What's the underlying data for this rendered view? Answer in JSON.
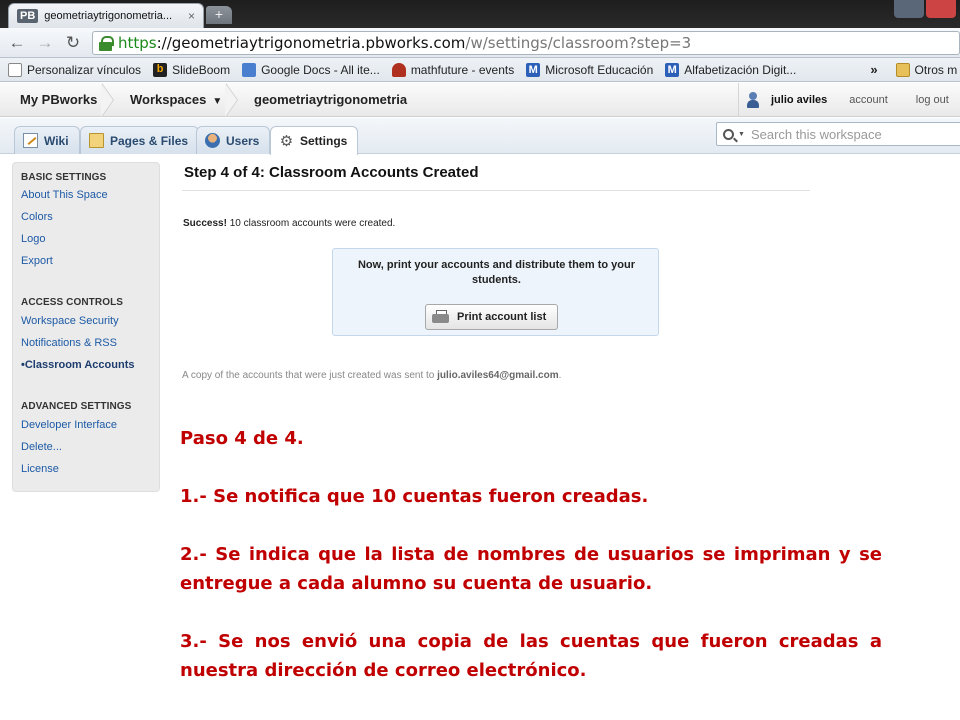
{
  "browser": {
    "tab_favicon": "PB",
    "tab_title": "geometriaytrigonometria...",
    "tab_close": "×",
    "new_tab": "+",
    "back": "←",
    "forward": "→",
    "reload": "↻",
    "url_proto": "https",
    "url_host": "://geometriaytrigonometria.pbworks.com",
    "url_path": "/w/settings/classroom?step=3",
    "bookmarks": [
      {
        "label": "Personalizar vínculos",
        "icon": "page-icon"
      },
      {
        "label": "SlideBoom",
        "icon": "slideboom-icon"
      },
      {
        "label": "Google Docs - All ite...",
        "icon": "google-docs-icon"
      },
      {
        "label": "mathfuture - events",
        "icon": "mathfuture-icon"
      },
      {
        "label": "Microsoft Educación",
        "icon": "microsoft-icon"
      },
      {
        "label": "Alfabetización Digit...",
        "icon": "microsoft-icon"
      }
    ],
    "bookmarks_more": "»",
    "other_bookmarks": "Otros m"
  },
  "header": {
    "my_pbworks": "My PBworks",
    "workspaces": "Workspaces",
    "workspaces_chevron": "▼",
    "workspace_name": "geometriaytrigonometria",
    "username": "julio aviles",
    "account": "account",
    "logout": "log out"
  },
  "tabs": [
    {
      "label": "Wiki",
      "active": false
    },
    {
      "label": "Pages & Files",
      "active": false
    },
    {
      "label": "Users",
      "active": false
    },
    {
      "label": "Settings",
      "active": true
    }
  ],
  "search": {
    "placeholder": "Search this workspace"
  },
  "sidebar": {
    "basic_head": "BASIC SETTINGS",
    "basic_items": [
      "About This Space",
      "Colors",
      "Logo",
      "Export"
    ],
    "access_head": "ACCESS CONTROLS",
    "access_items": [
      "Workspace Security",
      "Notifications & RSS",
      "Classroom Accounts"
    ],
    "current_marker": "•",
    "advanced_head": "ADVANCED SETTINGS",
    "advanced_items": [
      "Developer Interface",
      "Delete...",
      "License"
    ]
  },
  "main": {
    "title": "Step 4 of 4: Classroom Accounts Created",
    "success_label": "Success!",
    "success_text": " 10 classroom accounts were created.",
    "notice_text": "Now, print your accounts and distribute them to your students.",
    "print_button": "Print account list",
    "copy_prefix": "A copy of the accounts that were just created was sent to ",
    "copy_email": "julio.aviles64@gmail.com",
    "copy_suffix": "."
  },
  "annotation": {
    "line1": "Paso 4 de 4.",
    "line2": "1.- Se notifica que 10 cuentas fueron creadas.",
    "line3": "2.- Se indica que la lista de nombres de usuarios se impriman y se entregue a cada alumno su cuenta de usuario.",
    "line4": "3.- Se nos envió  una copia de las cuentas que fueron creadas a nuestra dirección de correo electrónico."
  },
  "colors": {
    "annotation_red": "#c00000",
    "link_blue": "#1d5aa6",
    "notice_bg": "#edf4fb",
    "url_green": "#1a8a1a"
  }
}
